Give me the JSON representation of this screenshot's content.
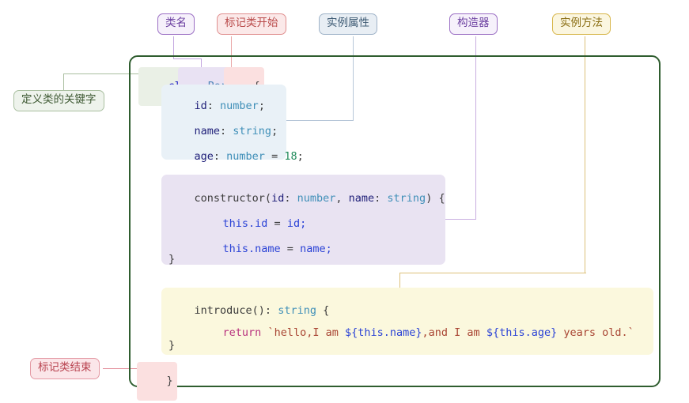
{
  "diagram": {
    "title_labels": [
      {
        "id": "class-name",
        "text": "类名",
        "color": "#9b6fc4"
      },
      {
        "id": "class-start",
        "text": "标记类开始",
        "color": "#e08f8f"
      },
      {
        "id": "instance-prop",
        "text": "实例属性",
        "color": "#9fb3c8"
      },
      {
        "id": "constructor",
        "text": "构造器",
        "color": "#9b6fc4"
      },
      {
        "id": "instance-method",
        "text": "实例方法",
        "color": "#d7b64a"
      },
      {
        "id": "class-keyword",
        "text": "定义类的关键字",
        "color": "#a9bfa0"
      },
      {
        "id": "class-end",
        "text": "标记类结束",
        "color": "#e49aa4"
      }
    ],
    "container_border_color": "#2f5d2f"
  },
  "code": {
    "header": {
      "keyword": "class",
      "class_name": "Person",
      "open_brace": "{"
    },
    "properties_block": {
      "background": "#e9f1f7",
      "lines": [
        {
          "name": "id",
          "sep": ": ",
          "type": "number",
          "end": ";"
        },
        {
          "name": "name",
          "sep": ": ",
          "type": "string",
          "end": ";"
        },
        {
          "name": "age",
          "sep": ": ",
          "type": "number",
          "assign": " = ",
          "value": "18",
          "end": ";"
        }
      ]
    },
    "constructor_block": {
      "background": "#e9e3f2",
      "signature": {
        "name": "constructor",
        "params": "(id: number, name: string)",
        "p1_name": "id",
        "p1_type": "number",
        "p2_name": "name",
        "p2_type": "string",
        "open": "{"
      },
      "body": [
        {
          "lhs": "this.id",
          "op": " = ",
          "rhs": "id;"
        },
        {
          "lhs": "this.name",
          "op": " = ",
          "rhs": "name;"
        }
      ],
      "close_brace": "}"
    },
    "method_block": {
      "background": "#fbf8dd",
      "signature": {
        "name": "introduce()",
        "sep": ": ",
        "type": "string",
        "open": " {"
      },
      "return_keyword": "return",
      "return_value": "`hello,I am ${this.name},and I am ${this.age} years old.`",
      "return_parts": [
        {
          "kind": "str",
          "text": "`hello,I am "
        },
        {
          "kind": "tmpl",
          "text": "${this.name}"
        },
        {
          "kind": "str",
          "text": ",and I am "
        },
        {
          "kind": "tmpl",
          "text": "${this.age}"
        },
        {
          "kind": "str",
          "text": " years old.`"
        }
      ],
      "close_brace": "}"
    },
    "class_close_brace": "}"
  }
}
